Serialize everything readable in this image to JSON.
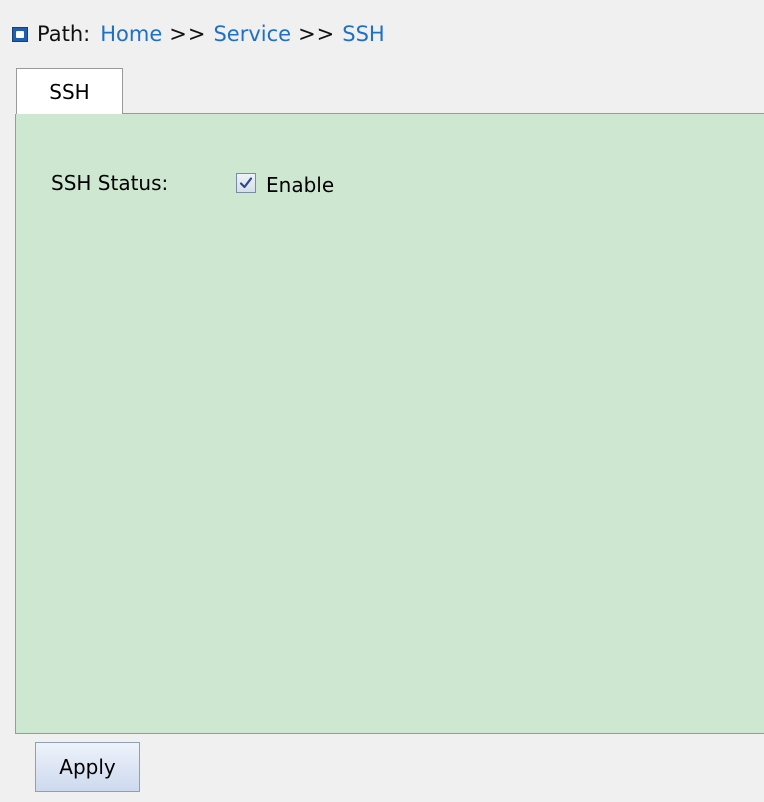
{
  "breadcrumb": {
    "icon": "page-icon",
    "label": "Path:",
    "items": [
      "Home",
      "Service",
      "SSH"
    ],
    "separator": ">>"
  },
  "tabs": [
    {
      "label": "SSH",
      "active": true
    }
  ],
  "form": {
    "ssh_status_label": "SSH Status:",
    "enable_label": "Enable",
    "enable_checked": true
  },
  "actions": {
    "apply_label": "Apply"
  },
  "colors": {
    "page_background": "#f0f0f0",
    "panel_background": "#cde7d0",
    "link": "#1e6fc8",
    "icon": "#1f5fb0"
  }
}
